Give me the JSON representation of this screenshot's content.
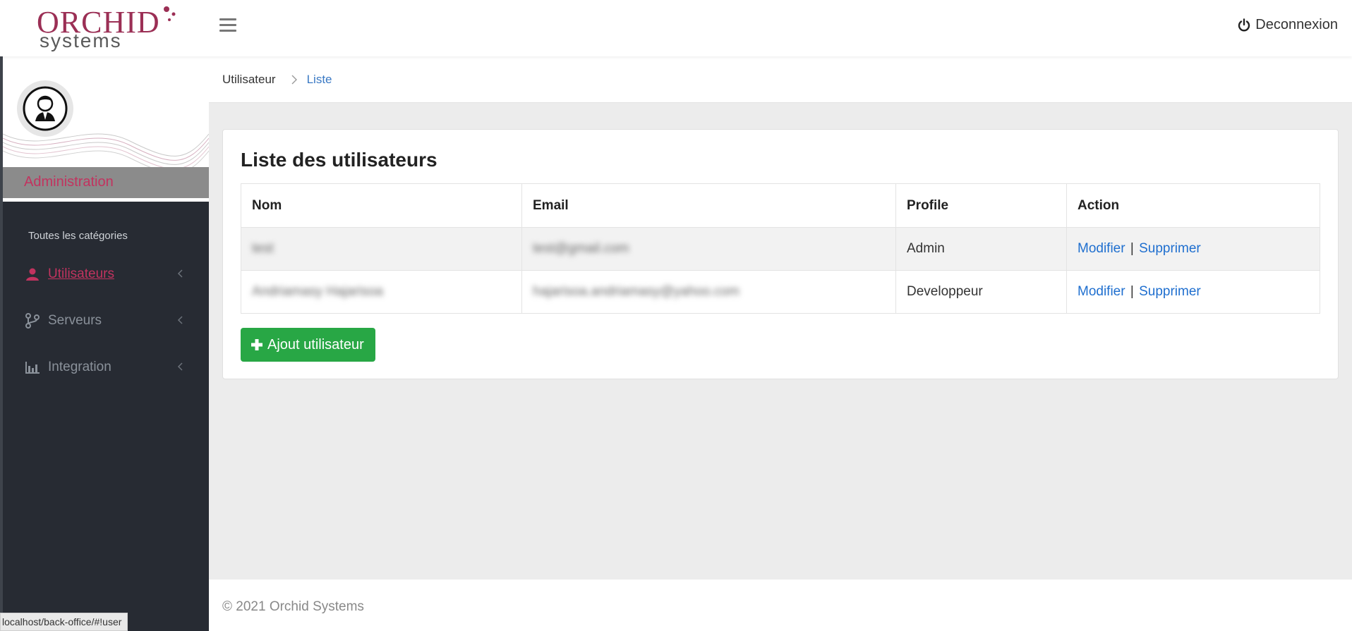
{
  "header": {
    "logo_top": "ORCHID",
    "logo_bottom": "systems",
    "logout_label": "Deconnexion"
  },
  "sidebar": {
    "role": "Administration",
    "category_title": "Toutes les catégories",
    "items": [
      {
        "label": "Utilisateurs",
        "icon": "user-icon",
        "active": true
      },
      {
        "label": "Serveurs",
        "icon": "branch-icon",
        "active": false
      },
      {
        "label": "Integration",
        "icon": "bar-chart-icon",
        "active": false
      }
    ]
  },
  "breadcrumb": {
    "home": "Utilisateur",
    "current": "Liste"
  },
  "card": {
    "title": "Liste des utilisateurs",
    "columns": [
      "Nom",
      "Email",
      "Profile",
      "Action"
    ],
    "rows": [
      {
        "nom": "test",
        "email": "test@gmail.com",
        "profile": "Admin",
        "modify": "Modifier",
        "separator": "|",
        "delete": "Supprimer"
      },
      {
        "nom": "Andriamasy Hajarisoa",
        "email": "hajarisoa.andriamasy@yahoo.com",
        "profile": "Developpeur",
        "modify": "Modifier",
        "separator": "|",
        "delete": "Supprimer"
      }
    ],
    "add_button": "Ajout utilisateur"
  },
  "footer": {
    "copyright": "© 2021 Orchid Systems"
  },
  "status_bar": {
    "url": "localhost/back-office/#!user"
  },
  "colors": {
    "brand": "#9b2f55",
    "accent_pink": "#c2335f",
    "link_blue": "#1f6fcf",
    "success_green": "#28a745",
    "sidebar_bg": "#272b33"
  }
}
